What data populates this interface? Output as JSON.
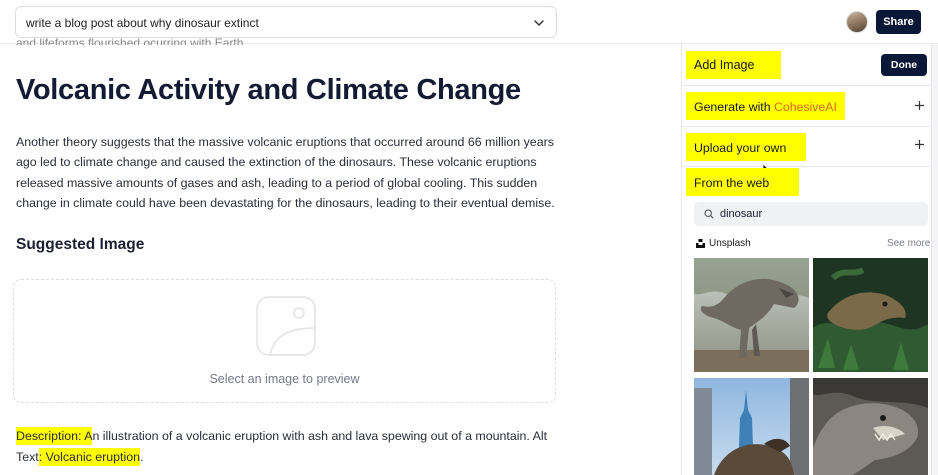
{
  "topbar": {
    "prompt": "write a blog post about why dinosaur extinct",
    "share_label": "Share"
  },
  "article": {
    "cut_line": "and lifeforms flourished ocurring with Earth.",
    "heading": "Volcanic Activity and Climate Change",
    "paragraph": "Another theory suggests that the massive volcanic eruptions that occurred around 66 million years ago led to climate change and caused the extinction of the dinosaurs. These volcanic eruptions released massive amounts of gases and ash, leading to a period of global cooling. This sudden change in climate could have been devastating for the dinosaurs, leading to their eventual demise.",
    "suggested_image_heading": "Suggested Image",
    "drop_zone_caption": "Select an image to preview",
    "description_label": "Description: ",
    "description_first_letter": "A",
    "description_text": "n illustration of a volcanic eruption with ash and lava spewing out of a mountain. Alt Text",
    "description_colon": ":",
    "alt_text": " Volcanic eruption",
    "alt_period": "."
  },
  "panel": {
    "title": "Add Image",
    "done_label": "Done",
    "generate_prefix": "Generate with ",
    "generate_brand": "CohesiveAI",
    "upload_label": "Upload your own",
    "web_label": "From the web",
    "search_value": "dinosaur",
    "source_label": "Unsplash",
    "see_more_label": "See more",
    "images": [
      {
        "subject": "t-rex model in forest"
      },
      {
        "subject": "dinosaur head in jungle plants"
      },
      {
        "subject": "dinosaur under city tower"
      },
      {
        "subject": "t-rex statue close-up"
      }
    ]
  },
  "colors": {
    "primary_button": "#0b1736",
    "highlight": "#ffff00",
    "accent": "#d46c16"
  }
}
